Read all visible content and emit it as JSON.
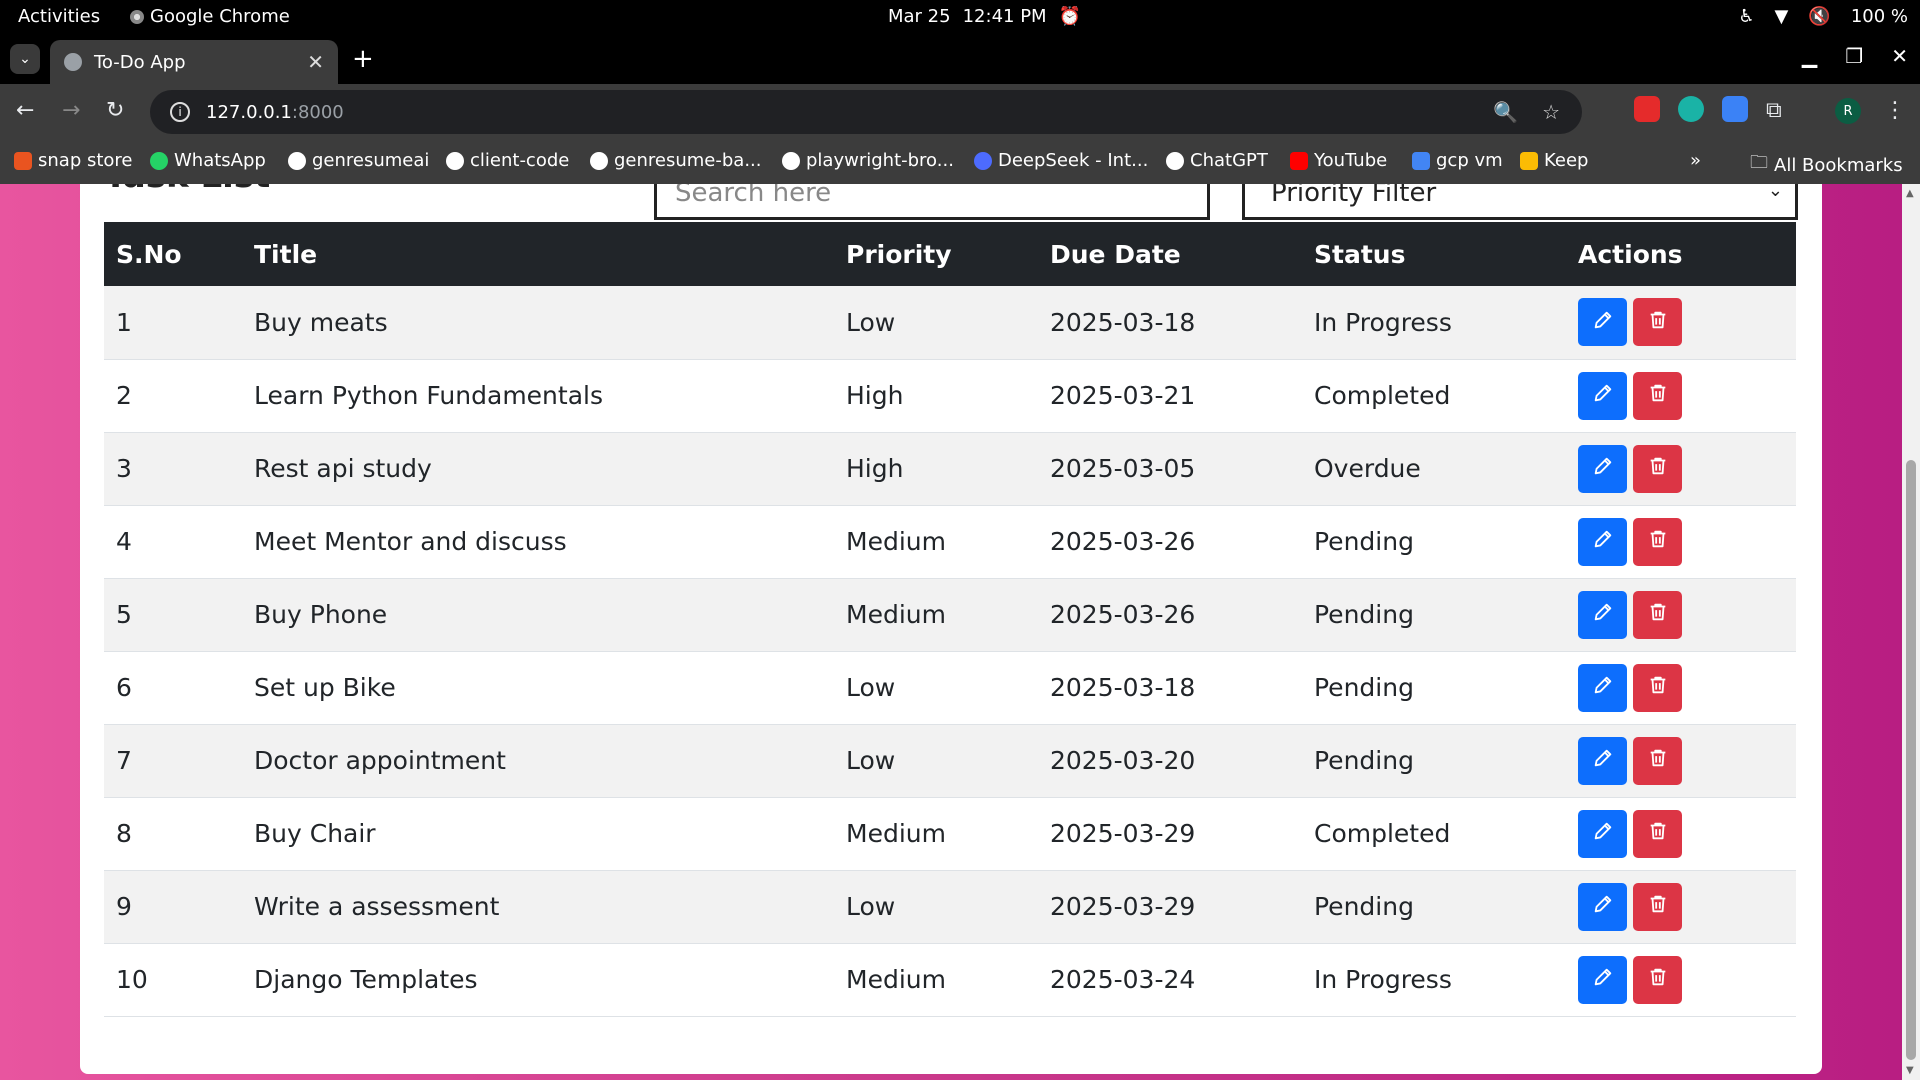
{
  "system_bar": {
    "activities": "Activities",
    "app_name": "Google Chrome",
    "date": "Mar 25",
    "time": "12:41 PM",
    "battery": "100 %"
  },
  "browser": {
    "tab_title": "To-Do App",
    "url_host": "127.0.0.1",
    "url_port": ":8000",
    "profile_initial": "R"
  },
  "bookmarks": [
    {
      "label": "snap store",
      "color": "#e95420"
    },
    {
      "label": "WhatsApp",
      "color": "#25d366"
    },
    {
      "label": "genresumeai",
      "color": "#ffffff"
    },
    {
      "label": "client-code",
      "color": "#ffffff"
    },
    {
      "label": "genresume-ba...",
      "color": "#ffffff"
    },
    {
      "label": "playwright-bro...",
      "color": "#ffffff"
    },
    {
      "label": "DeepSeek - Int...",
      "color": "#4d6bfe"
    },
    {
      "label": "ChatGPT",
      "color": "#ffffff"
    },
    {
      "label": "YouTube",
      "color": "#ff0000"
    },
    {
      "label": "gcp vm",
      "color": "#4285f4"
    },
    {
      "label": "Keep",
      "color": "#fbbc04"
    }
  ],
  "all_bookmarks": "All Bookmarks",
  "page": {
    "heading": "Task List",
    "search_placeholder": "Search here",
    "priority_filter": "Priority Filter"
  },
  "table": {
    "headers": [
      "S.No",
      "Title",
      "Priority",
      "Due Date",
      "Status",
      "Actions"
    ],
    "rows": [
      {
        "sno": "1",
        "title": "Buy meats",
        "priority": "Low",
        "due": "2025-03-18",
        "status": "In Progress"
      },
      {
        "sno": "2",
        "title": "Learn Python Fundamentals",
        "priority": "High",
        "due": "2025-03-21",
        "status": "Completed"
      },
      {
        "sno": "3",
        "title": "Rest api study",
        "priority": "High",
        "due": "2025-03-05",
        "status": "Overdue"
      },
      {
        "sno": "4",
        "title": "Meet Mentor and discuss",
        "priority": "Medium",
        "due": "2025-03-26",
        "status": "Pending"
      },
      {
        "sno": "5",
        "title": "Buy Phone",
        "priority": "Medium",
        "due": "2025-03-26",
        "status": "Pending"
      },
      {
        "sno": "6",
        "title": "Set up Bike",
        "priority": "Low",
        "due": "2025-03-18",
        "status": "Pending"
      },
      {
        "sno": "7",
        "title": "Doctor appointment",
        "priority": "Low",
        "due": "2025-03-20",
        "status": "Pending"
      },
      {
        "sno": "8",
        "title": "Buy Chair",
        "priority": "Medium",
        "due": "2025-03-29",
        "status": "Completed"
      },
      {
        "sno": "9",
        "title": "Write a assessment",
        "priority": "Low",
        "due": "2025-03-29",
        "status": "Pending"
      },
      {
        "sno": "10",
        "title": "Django Templates",
        "priority": "Medium",
        "due": "2025-03-24",
        "status": "In Progress"
      }
    ]
  },
  "colors": {
    "edit_button": "#0d6efd",
    "delete_button": "#dc3545",
    "table_header": "#212529"
  }
}
